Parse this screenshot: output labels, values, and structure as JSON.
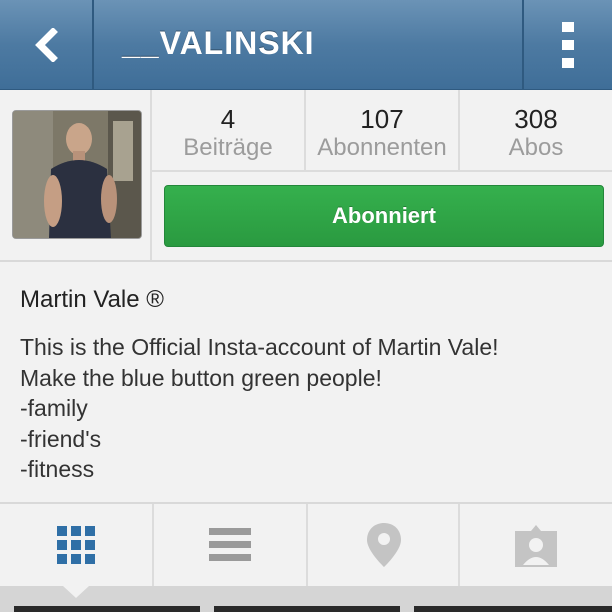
{
  "header": {
    "title": "__VALINSKI",
    "back_icon": "chevron-left-icon",
    "menu_icon": "more-vertical-icon",
    "color": "#4d7aa2"
  },
  "profile": {
    "stats": [
      {
        "value": "4",
        "label": "Beiträge"
      },
      {
        "value": "107",
        "label": "Abonnenten"
      },
      {
        "value": "308",
        "label": "Abos"
      }
    ],
    "follow_button_label": "Abonniert",
    "follow_button_color": "#2ea447"
  },
  "bio": {
    "name": "Martin Vale ®",
    "lines": [
      "This is the Official Insta-account of Martin Vale!",
      "Make the blue button green people!",
      "-family",
      "-friend's",
      "-fitness"
    ]
  },
  "tabs": [
    {
      "icon": "grid-icon",
      "active": true
    },
    {
      "icon": "list-icon",
      "active": false
    },
    {
      "icon": "location-pin-icon",
      "active": false
    },
    {
      "icon": "tagged-person-icon",
      "active": false
    }
  ]
}
